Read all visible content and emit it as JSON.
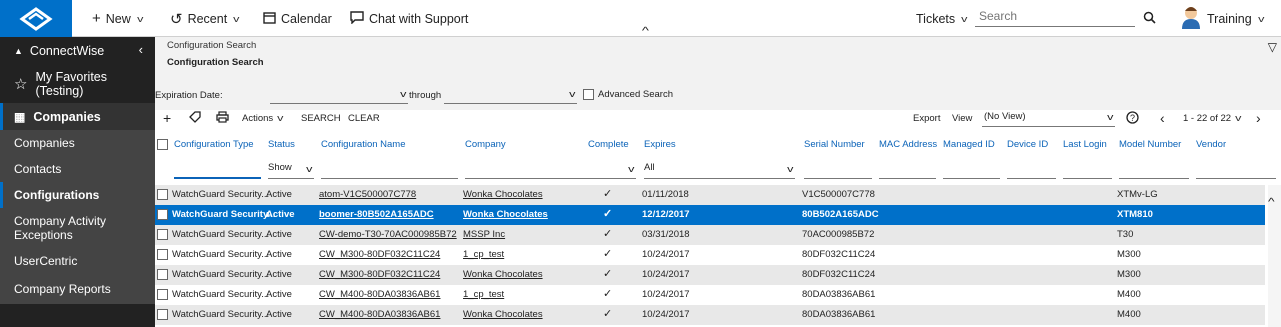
{
  "nav": {
    "new_label": "New",
    "recent_label": "Recent",
    "calendar_label": "Calendar",
    "support_label": "Chat with Support",
    "tickets_label": "Tickets",
    "search_placeholder": "Search",
    "user_label": "Training"
  },
  "sidebar": {
    "brand": "ConnectWise",
    "favorites": "My Favorites (Testing)",
    "section": "Companies",
    "items": [
      "Companies",
      "Contacts",
      "Configurations",
      "Company Activity Exceptions",
      "UserCentric",
      "Company Reports"
    ]
  },
  "page": {
    "breadcrumb": "Configuration Search",
    "title": "Configuration Search",
    "expiration_label": "Expiration Date:",
    "through_label": "through",
    "advanced_label": "Advanced Search"
  },
  "toolbar": {
    "actions": "Actions",
    "search": "SEARCH",
    "clear": "CLEAR",
    "export": "Export",
    "view": "View",
    "view_value": "(No View)",
    "paging": "1 - 22 of 22"
  },
  "columns": [
    "Configuration Type",
    "Status",
    "Configuration Name",
    "Company",
    "Complete",
    "Expires",
    "Serial Number",
    "MAC Address",
    "Managed ID",
    "Device ID",
    "Last Login",
    "Model Number",
    "Vendor"
  ],
  "filters": {
    "status": "Show",
    "expires": "All"
  },
  "rows": [
    {
      "type": "WatchGuard Security...",
      "status": "Active",
      "name": "atom-V1C500007C778",
      "company": "Wonka Chocolates",
      "expires": "01/11/2018",
      "serial": "V1C500007C778",
      "model": "XTMv-LG"
    },
    {
      "type": "WatchGuard Security...",
      "status": "Active",
      "name": "boomer-80B502A165ADC",
      "company": "Wonka Chocolates",
      "expires": "12/12/2017",
      "serial": "80B502A165ADC",
      "model": "XTM810"
    },
    {
      "type": "WatchGuard Security...",
      "status": "Active",
      "name": "CW-demo-T30-70AC000985B72",
      "company": "MSSP Inc",
      "expires": "03/31/2018",
      "serial": "70AC000985B72",
      "model": "T30"
    },
    {
      "type": "WatchGuard Security...",
      "status": "Active",
      "name": "CW_M300-80DF032C11C24",
      "company": "1_cp_test",
      "expires": "10/24/2017",
      "serial": "80DF032C11C24",
      "model": "M300"
    },
    {
      "type": "WatchGuard Security...",
      "status": "Active",
      "name": "CW_M300-80DF032C11C24",
      "company": "Wonka Chocolates",
      "expires": "10/24/2017",
      "serial": "80DF032C11C24",
      "model": "M300"
    },
    {
      "type": "WatchGuard Security...",
      "status": "Active",
      "name": "CW_M400-80DA03836AB61",
      "company": "1_cp_test",
      "expires": "10/24/2017",
      "serial": "80DA03836AB61",
      "model": "M400"
    },
    {
      "type": "WatchGuard Security...",
      "status": "Active",
      "name": "CW_M400-80DA03836AB61",
      "company": "Wonka Chocolates",
      "expires": "10/24/2017",
      "serial": "80DA03836AB61",
      "model": "M400"
    }
  ],
  "selected_row": 1,
  "colors": {
    "accent": "#0070c9",
    "sidebar": "#222222",
    "link": "#0b63b8"
  }
}
